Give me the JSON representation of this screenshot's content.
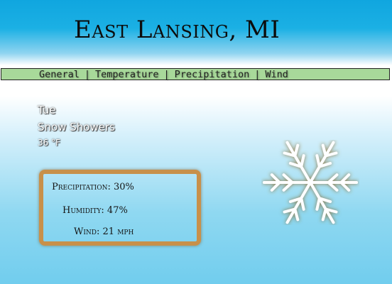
{
  "header": {
    "title": "East Lansing, MI"
  },
  "tabs": [
    {
      "label": "General"
    },
    {
      "label": "Temperature"
    },
    {
      "label": "Precipitation"
    },
    {
      "label": "Wind"
    }
  ],
  "tab_separator": "|",
  "summary": {
    "day": "Tue",
    "condition": "Snow Showers",
    "temperature": "36 °F"
  },
  "details": {
    "precipitation": "Precipitation: 30%",
    "humidity": "Humidity: 47%",
    "wind": "Wind: 21 mph"
  },
  "icon": {
    "name": "snowflake-icon",
    "color": "#ffffff",
    "glow_color": "#8a6a2a"
  },
  "colors": {
    "header_blue": "#10a6df",
    "tabbar_green": "#a8d99a",
    "box_border": "#c8904a"
  }
}
